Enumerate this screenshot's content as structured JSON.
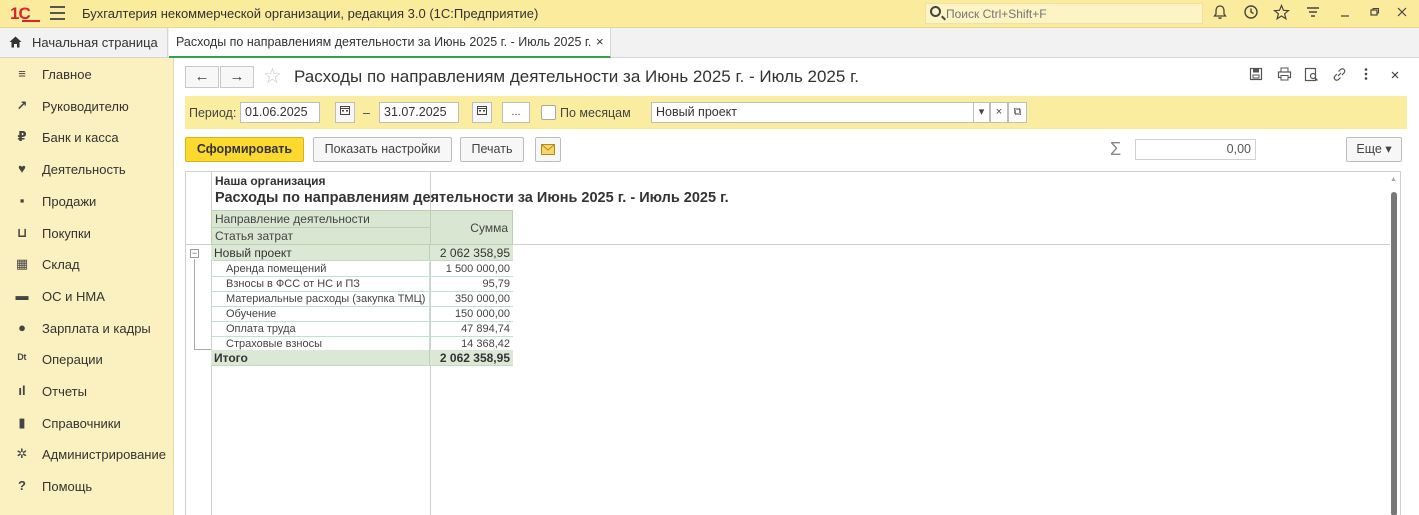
{
  "titlebar": {
    "logo": "1С",
    "app_title": "Бухгалтерия некоммерческой организации, редакция 3.0  (1С:Предприятие)",
    "search_placeholder": "Поиск Ctrl+Shift+F",
    "icons": [
      "bell-icon",
      "history-icon",
      "star-icon",
      "filter-icon",
      "minimize-icon",
      "restore-icon",
      "close-icon"
    ]
  },
  "tabs": {
    "home_label": "Начальная страница",
    "doc_label": "Расходы по направлениям деятельности за Июнь 2025 г. - Июль 2025 г.",
    "close_glyph": "×"
  },
  "sidebar": {
    "items": [
      {
        "label": "Главное",
        "icon": "≡"
      },
      {
        "label": "Руководителю",
        "icon": "↗"
      },
      {
        "label": "Банк и касса",
        "icon": "₽"
      },
      {
        "label": "Деятельность",
        "icon": "♥"
      },
      {
        "label": "Продажи",
        "icon": "▪"
      },
      {
        "label": "Покупки",
        "icon": "⊔"
      },
      {
        "label": "Склад",
        "icon": "▦"
      },
      {
        "label": "ОС и НМА",
        "icon": "▬"
      },
      {
        "label": "Зарплата и кадры",
        "icon": "●"
      },
      {
        "label": "Операции",
        "icon": "ᴰᵗ"
      },
      {
        "label": "Отчеты",
        "icon": "ıl"
      },
      {
        "label": "Справочники",
        "icon": "▮"
      },
      {
        "label": "Администрирование",
        "icon": "✲"
      },
      {
        "label": "Помощь",
        "icon": "?"
      }
    ]
  },
  "form": {
    "title": "Расходы по направлениям деятельности за Июнь 2025 г. - Июль 2025 г.",
    "back": "←",
    "forward": "→",
    "star": "☆"
  },
  "params": {
    "period_label": "Период:",
    "date_from": "01.06.2025",
    "dash": "–",
    "date_to": "31.07.2025",
    "more": "...",
    "by_months_label": "По месяцам",
    "project": "Новый проект",
    "dropdown": "▾",
    "clear": "×",
    "open": "⧉"
  },
  "commands": {
    "generate": "Сформировать",
    "settings": "Показать настройки",
    "print": "Печать",
    "sum_value": "0,00",
    "more": "Еще ▾"
  },
  "report": {
    "org": "Наша организация",
    "title": "Расходы по направлениям деятельности за Июнь 2025 г. - Июль 2025 г.",
    "col_direction": "Направление деятельности",
    "col_cost_item": "Статья затрат",
    "col_sum": "Сумма",
    "group": {
      "name": "Новый проект",
      "value": "2 062 358,95"
    },
    "rows": [
      {
        "name": "Аренда помещений",
        "value": "1 500 000,00"
      },
      {
        "name": "Взносы в ФСС от НС и ПЗ",
        "value": "95,79"
      },
      {
        "name": "Материальные расходы (закупка ТМЦ)",
        "value": "350 000,00"
      },
      {
        "name": "Обучение",
        "value": "150 000,00"
      },
      {
        "name": "Оплата труда",
        "value": "47 894,74"
      },
      {
        "name": "Страховые взносы",
        "value": "14 368,42"
      }
    ],
    "total": {
      "name": "Итого",
      "value": "2 062 358,95"
    }
  }
}
